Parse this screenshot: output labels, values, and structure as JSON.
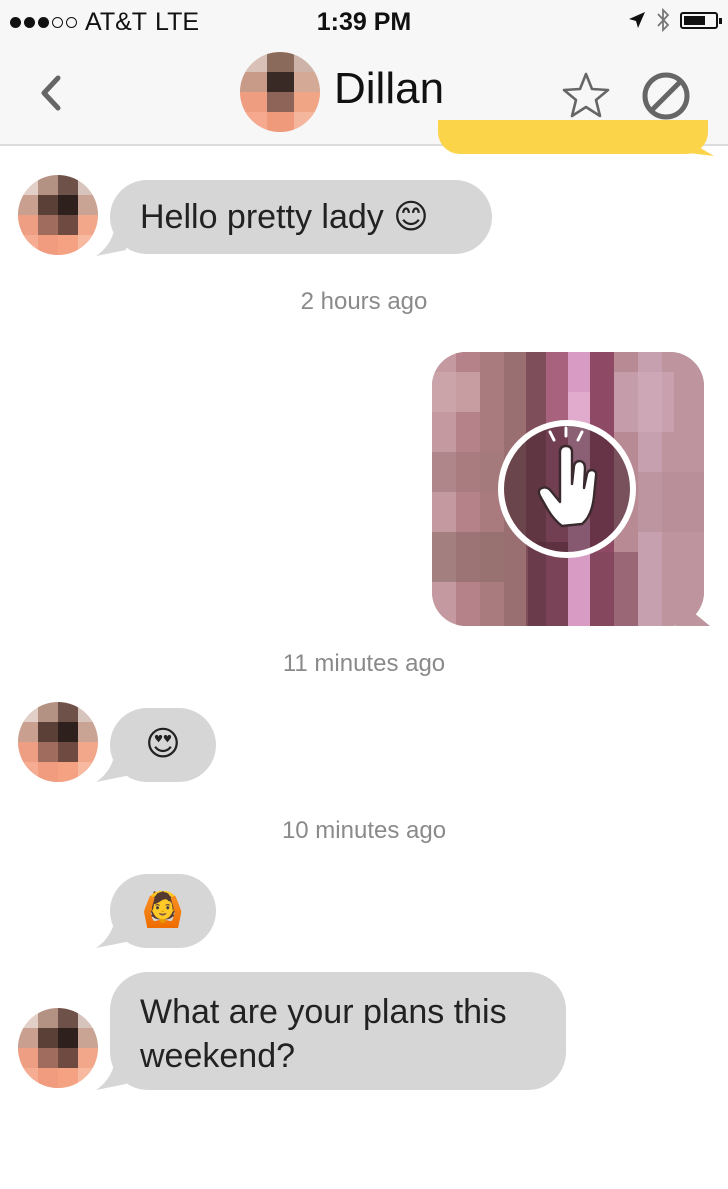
{
  "status_bar": {
    "carrier": "AT&T",
    "network": "LTE",
    "time": "1:39 PM",
    "signal_bars": 3,
    "battery_level": 0.7
  },
  "header": {
    "contact_name": "Dillan",
    "icons": [
      "back-chevron-icon",
      "star-icon",
      "block-icon"
    ]
  },
  "messages": [
    {
      "id": "m1",
      "from": "contact",
      "text": "Hello pretty lady 😊"
    },
    {
      "id": "t1",
      "type": "timestamp",
      "text": "2 hours ago"
    },
    {
      "id": "m2",
      "from": "me",
      "type": "photo",
      "icon": "tap-to-view-hand-icon"
    },
    {
      "id": "t2",
      "type": "timestamp",
      "text": "11 minutes ago"
    },
    {
      "id": "m3",
      "from": "contact",
      "text": "😍"
    },
    {
      "id": "t3",
      "type": "timestamp",
      "text": "10 minutes ago"
    },
    {
      "id": "m4",
      "from": "contact",
      "text": "🙆"
    },
    {
      "id": "m5",
      "from": "contact",
      "text_line1": "What are your plans this",
      "text_line2": "weekend?"
    }
  ],
  "colors": {
    "incoming_bubble": "#d6d6d6",
    "outgoing_accent": "#fcd44a",
    "timestamp": "#8a8a8a"
  }
}
